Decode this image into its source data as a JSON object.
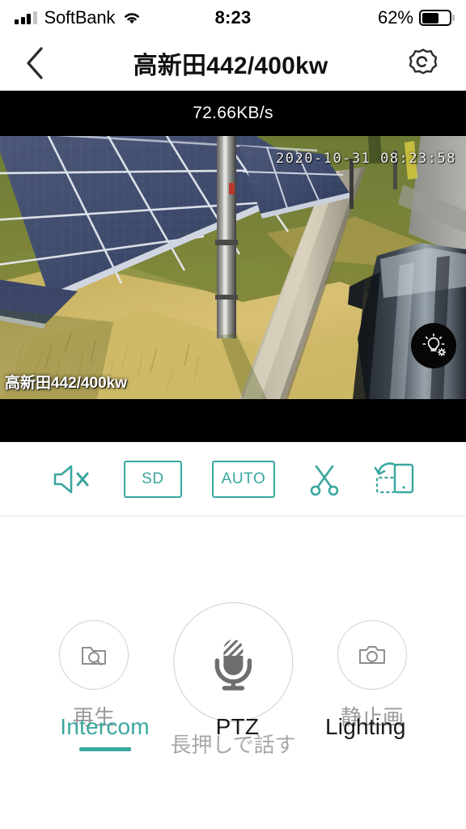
{
  "status_bar": {
    "carrier": "SoftBank",
    "time": "8:23",
    "battery_percent": "62%",
    "signal_icon": "signal-bars-icon",
    "wifi_icon": "wifi-icon",
    "battery_icon": "battery-icon"
  },
  "header": {
    "title": "高新田442/400kw",
    "back_icon": "chevron-left-icon",
    "settings_icon": "gear-icon"
  },
  "video": {
    "bitrate": "72.66KB/s",
    "timestamp_overlay": "2020-10-31 08:23:58",
    "camera_label": "高新田442/400kw",
    "light_icon": "lightbulb-gear-icon",
    "scene_description": "solar panel array, grass field, utility pole, parked car"
  },
  "toolbar": {
    "items": [
      {
        "name": "mute-toggle",
        "icon": "speaker-mute-icon",
        "label": ""
      },
      {
        "name": "quality-toggle",
        "icon": "",
        "label": "SD"
      },
      {
        "name": "auto-toggle",
        "icon": "",
        "label": "AUTO"
      },
      {
        "name": "clip-button",
        "icon": "scissors-icon",
        "label": ""
      },
      {
        "name": "rotate-button",
        "icon": "rotate-screen-icon",
        "label": ""
      }
    ]
  },
  "controls": {
    "playback": {
      "label": "再生",
      "icon": "folder-search-icon"
    },
    "talk": {
      "hint": "長押しで話す",
      "icon": "microphone-icon"
    },
    "snapshot": {
      "label": "静止画",
      "icon": "camera-icon"
    }
  },
  "tabs": [
    {
      "label": "Intercom",
      "active": true
    },
    {
      "label": "PTZ",
      "active": false
    },
    {
      "label": "Lighting",
      "active": false
    }
  ],
  "colors": {
    "accent": "#3aa79f",
    "text_primary": "#111111",
    "text_muted": "#9a9a9a",
    "video_bg": "#000000"
  }
}
